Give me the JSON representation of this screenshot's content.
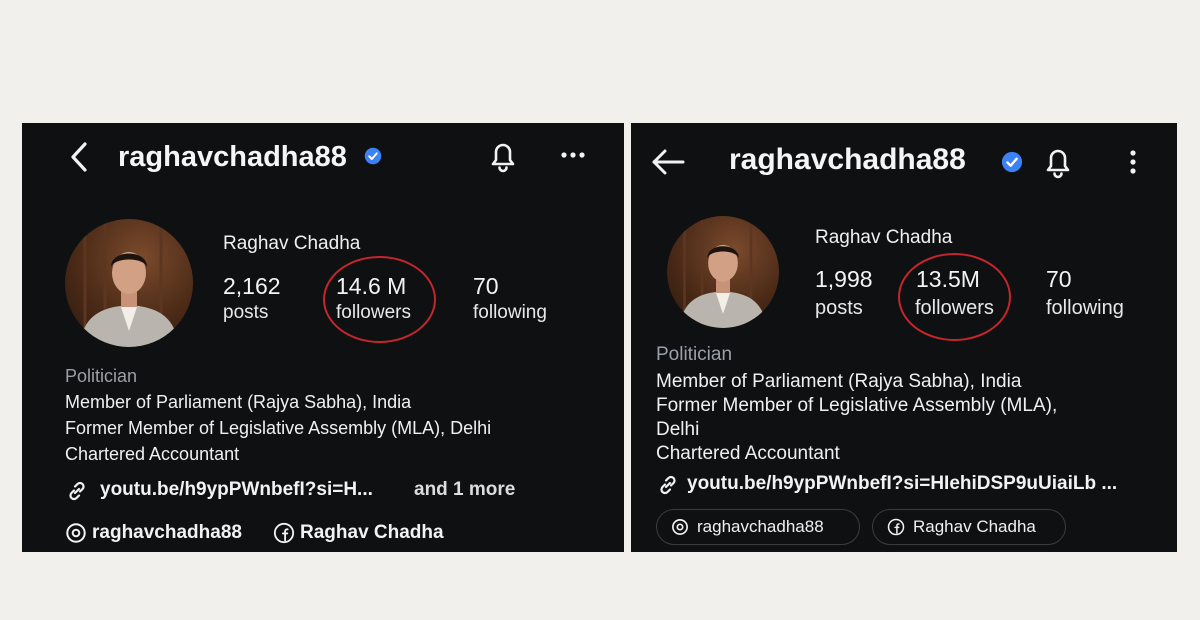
{
  "colors": {
    "page_bg": "#f1f0ec",
    "panel_bg": "#0f1012",
    "verified": "#3b82f6",
    "highlight_ring": "#c4262b"
  },
  "left": {
    "username": "raghavchadha88",
    "name": "Raghav Chadha",
    "posts_count": "2,162",
    "posts_label": "posts",
    "followers_count": "14.6 M",
    "followers_label": "followers",
    "following_count": "70",
    "following_label": "following",
    "category": "Politician",
    "bio_line1": "Member of Parliament (Rajya Sabha), India",
    "bio_line2": "Former Member of Legislative Assembly (MLA), Delhi",
    "bio_line3": "Chartered Accountant",
    "link": "youtu.be/h9ypPWnbefI?si=H...",
    "link_more": "and 1 more",
    "threads_handle": "raghavchadha88",
    "facebook_name": "Raghav Chadha",
    "icons": [
      "chevron-left-icon",
      "verified-badge-icon",
      "bell-icon",
      "more-horizontal-icon",
      "link-icon",
      "threads-icon",
      "facebook-icon"
    ]
  },
  "right": {
    "username": "raghavchadha88",
    "name": "Raghav Chadha",
    "posts_count": "1,998",
    "posts_label": "posts",
    "followers_count": "13.5M",
    "followers_label": "followers",
    "following_count": "70",
    "following_label": "following",
    "category": "Politician",
    "bio_line1": "Member of Parliament (Rajya Sabha), India",
    "bio_line2": "Former Member of Legislative Assembly (MLA),",
    "bio_line3": "Delhi",
    "bio_line4": "Chartered Accountant",
    "link": "youtu.be/h9ypPWnbefI?si=HIehiDSP9uUiaiLb ...",
    "threads_handle": "raghavchadha88",
    "facebook_name": "Raghav Chadha",
    "icons": [
      "arrow-left-icon",
      "verified-badge-icon",
      "bell-icon",
      "more-vertical-icon",
      "link-icon",
      "threads-icon",
      "facebook-icon"
    ]
  }
}
